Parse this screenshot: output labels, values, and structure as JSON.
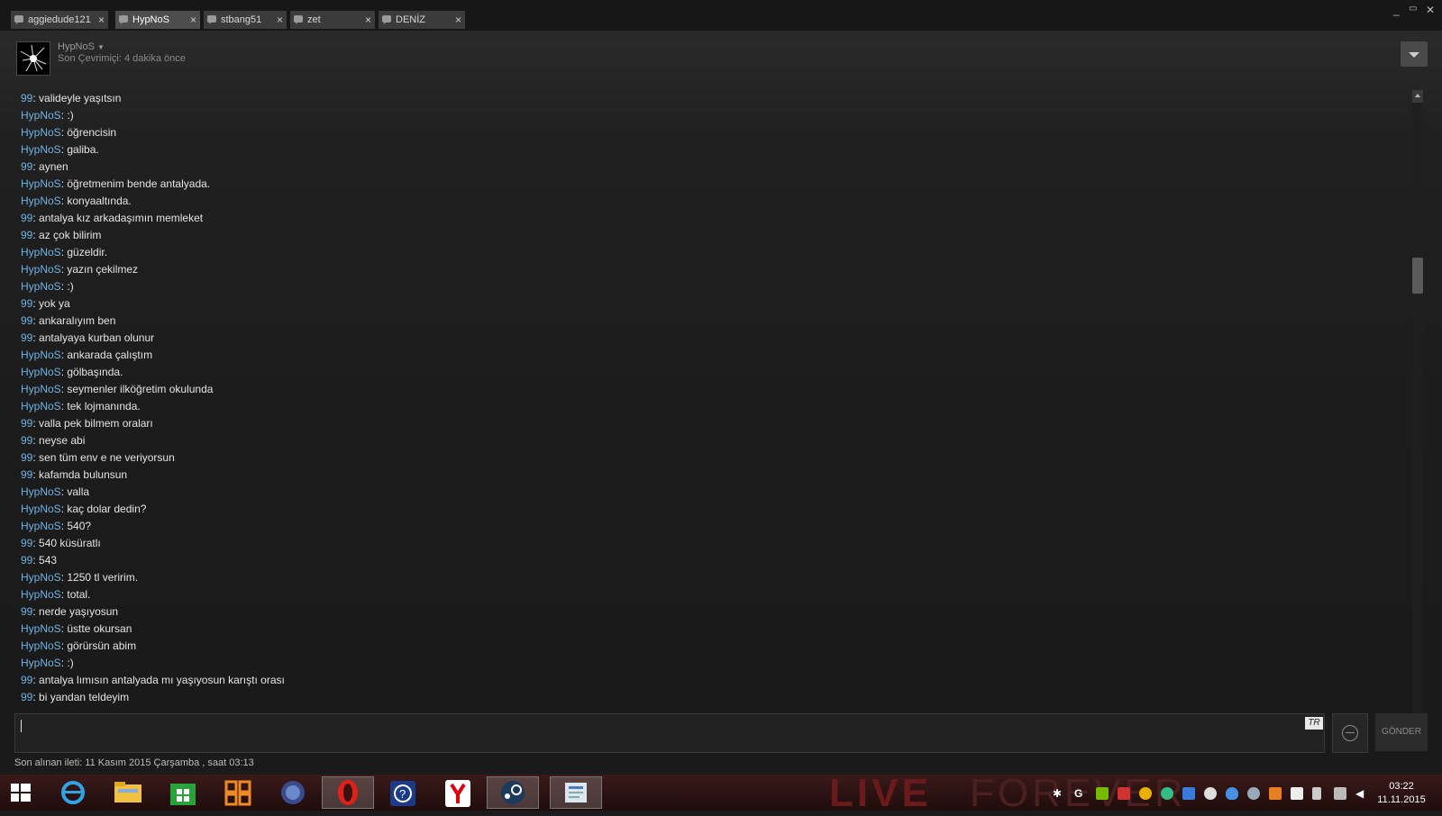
{
  "tabs": [
    {
      "label": "aggiedude121",
      "active": false
    },
    {
      "label": "HypNoS",
      "active": true
    },
    {
      "label": "stbang51",
      "active": false
    },
    {
      "label": "zet",
      "active": false
    },
    {
      "label": "DENİZ",
      "active": false
    }
  ],
  "tab_close_glyph": "×",
  "window_controls": {
    "minimize": "_",
    "maximize": "▭",
    "close": "✕"
  },
  "friend": {
    "name": "HypNoS",
    "status": "Son Çevrimiçi: 4 dakika önce"
  },
  "messages": [
    {
      "sender": "99",
      "text": "validеyle yaşıtsın"
    },
    {
      "sender": "HypNoS",
      "text": ":)"
    },
    {
      "sender": "HypNoS",
      "text": "öğrencisin"
    },
    {
      "sender": "HypNoS",
      "text": "galiba."
    },
    {
      "sender": "99",
      "text": "aynen"
    },
    {
      "sender": "HypNoS",
      "text": "öğretmenim bende antalyada."
    },
    {
      "sender": "HypNoS",
      "text": "konyaaltında."
    },
    {
      "sender": "99",
      "text": "antalya kız arkadaşımın memleket"
    },
    {
      "sender": "99",
      "text": "az çok bilirim"
    },
    {
      "sender": "HypNoS",
      "text": "güzeldir."
    },
    {
      "sender": "HypNoS",
      "text": "yazın çekilmez"
    },
    {
      "sender": "HypNoS",
      "text": ":)"
    },
    {
      "sender": "99",
      "text": "yok ya"
    },
    {
      "sender": "99",
      "text": "ankaralıyım ben"
    },
    {
      "sender": "99",
      "text": "antalyaya kurban olunur"
    },
    {
      "sender": "HypNoS",
      "text": "ankarada çalıştım"
    },
    {
      "sender": "HypNoS",
      "text": "gölbaşında."
    },
    {
      "sender": "HypNoS",
      "text": "seymenler ilköğretim okulunda"
    },
    {
      "sender": "HypNoS",
      "text": "tek lojmanında."
    },
    {
      "sender": "99",
      "text": "valla pek bilmem oraları"
    },
    {
      "sender": "99",
      "text": "neyse abi"
    },
    {
      "sender": "99",
      "text": "sen tüm env e ne veriyorsun"
    },
    {
      "sender": "99",
      "text": "kafamda bulunsun"
    },
    {
      "sender": "HypNoS",
      "text": "valla"
    },
    {
      "sender": "HypNoS",
      "text": "kaç dolar dedin?"
    },
    {
      "sender": "HypNoS",
      "text": "540?"
    },
    {
      "sender": "99",
      "text": "540 küsüratlı"
    },
    {
      "sender": "99",
      "text": "543"
    },
    {
      "sender": "HypNoS",
      "text": "1250 tl veririm."
    },
    {
      "sender": "HypNoS",
      "text": "total."
    },
    {
      "sender": "99",
      "text": "nerde yaşıyosun"
    },
    {
      "sender": "HypNoS",
      "text": "üstte okursan"
    },
    {
      "sender": "HypNoS",
      "text": "görürsün abim"
    },
    {
      "sender": "HypNoS",
      "text": ":)"
    },
    {
      "sender": "99",
      "text": "antalya lımısın antalyada mı yaşıyosun karıştı orası"
    },
    {
      "sender": "99",
      "text": "bi yandan teldeyim"
    }
  ],
  "input": {
    "value": "",
    "lang_badge": "TR"
  },
  "send_label": "GÖNDER",
  "last_message": "Son alınan ileti: 11 Kasım 2015 Çarşamba , saat 03:13",
  "watermark": {
    "part1": "LIVE",
    "part2": "FOREVER"
  },
  "taskbar_apps": [
    "windows-start-icon",
    "internet-explorer-icon",
    "file-explorer-icon",
    "store-icon",
    "office-icon",
    "firefox-icon",
    "opera-icon",
    "help-icon",
    "yandex-icon",
    "steam-icon",
    "document-icon"
  ],
  "clock": {
    "time": "03:22",
    "date": "11.11.2015"
  }
}
